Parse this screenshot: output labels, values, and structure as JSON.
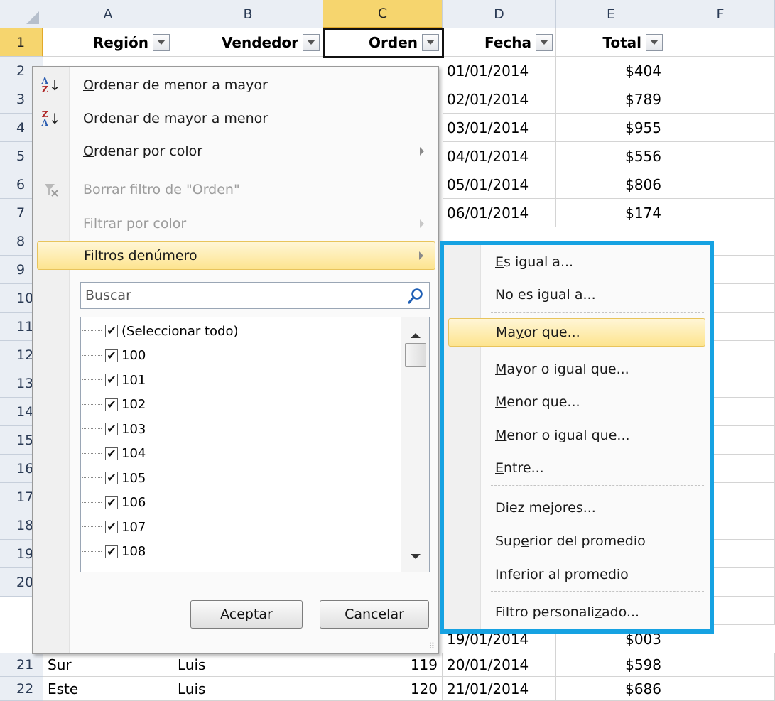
{
  "columns": [
    "A",
    "B",
    "C",
    "D",
    "E",
    "F"
  ],
  "selected_column": "C",
  "header_row": {
    "row_label": "1",
    "headers": [
      "Región",
      "Vendedor",
      "Orden",
      "Fecha",
      "Total"
    ]
  },
  "row_numbers": [
    "2",
    "3",
    "4",
    "5",
    "6",
    "7",
    "8",
    "9",
    "10",
    "11",
    "12",
    "13",
    "14",
    "15",
    "16",
    "17",
    "18",
    "19",
    "20",
    "21",
    "22"
  ],
  "visible_rows": [
    {
      "date": "01/01/2014",
      "total": "$404"
    },
    {
      "date": "02/01/2014",
      "total": "$789"
    },
    {
      "date": "03/01/2014",
      "total": "$955"
    },
    {
      "date": "04/01/2014",
      "total": "$556"
    },
    {
      "date": "05/01/2014",
      "total": "$806"
    },
    {
      "date": "06/01/2014",
      "total": "$174"
    }
  ],
  "row_20_partial": {
    "date": "19/01/2014",
    "total": "$003"
  },
  "bottom_rows": [
    {
      "row": "21",
      "region": "Sur",
      "seller": "Luis",
      "order": "119",
      "date": "20/01/2014",
      "total": "$598"
    },
    {
      "row": "22",
      "region": "Este",
      "seller": "Luis",
      "order": "120",
      "date": "21/01/2014",
      "total": "$686"
    }
  ],
  "filter_menu": {
    "sort_asc": {
      "pre": "",
      "u": "O",
      "post": "rdenar de menor a mayor"
    },
    "sort_desc": {
      "pre": "Or",
      "u": "d",
      "post": "enar de mayor a menor"
    },
    "sort_color": {
      "pre": "",
      "u": "O",
      "post": "rdenar por color"
    },
    "clear_filter": {
      "pre": "",
      "u": "B",
      "post": "orrar filtro de \"Orden\""
    },
    "filter_color": {
      "pre": "Filtrar por c",
      "u": "o",
      "post": "lor"
    },
    "number_filters": {
      "pre": "Filtros de ",
      "u": "n",
      "post": "úmero"
    },
    "search_placeholder": "Buscar",
    "list_items": [
      "(Seleccionar todo)",
      "100",
      "101",
      "102",
      "103",
      "104",
      "105",
      "106",
      "107",
      "108"
    ],
    "ok_label": "Aceptar",
    "cancel_label": "Cancelar"
  },
  "number_filters_submenu": {
    "equals": {
      "pre": "",
      "u": "E",
      "post": "s igual a..."
    },
    "not_equals": {
      "pre": "",
      "u": "N",
      "post": "o es igual a..."
    },
    "greater": {
      "pre": "Ma",
      "u": "y",
      "post": "or que..."
    },
    "greater_equal": {
      "pre": "",
      "u": "M",
      "post": "ayor o igual que..."
    },
    "less": {
      "pre": "",
      "u": "M",
      "post": "enor que..."
    },
    "less_equal": {
      "pre": "",
      "u": "M",
      "post": "enor o igual que..."
    },
    "between": {
      "pre": "",
      "u": "E",
      "post": "ntre..."
    },
    "top10": {
      "pre": "",
      "u": "D",
      "post": "iez mejores..."
    },
    "above_avg": {
      "pre": "Sup",
      "u": "e",
      "post": "rior del promedio"
    },
    "below_avg": {
      "pre": "",
      "u": "I",
      "post": "nferior al promedio"
    },
    "custom": {
      "pre": "Filtro personali",
      "u": "z",
      "post": "ado..."
    }
  },
  "colors": {
    "highlight_border": "#16a2e2",
    "selected_header": "#f6d56e",
    "menu_hover": "#fde48f"
  }
}
